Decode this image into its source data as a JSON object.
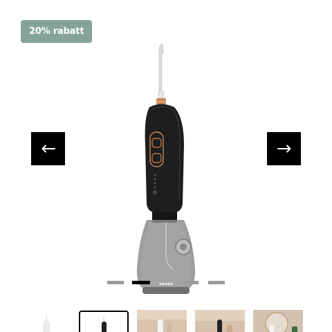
{
  "badge": {
    "label": "20% rabatt"
  },
  "product": {
    "image_icon": "water-flosser-image"
  },
  "carousel": {
    "prev_icon": "arrow-left-icon",
    "next_icon": "arrow-right-icon",
    "active_dot_index": 1,
    "dot_count": 4
  },
  "thumbnails": {
    "selected_index": 1,
    "items": [
      {
        "icon": "water-flosser-white-thumb"
      },
      {
        "icon": "water-flosser-black-thumb"
      },
      {
        "icon": "lifestyle-photo-thumb"
      },
      {
        "icon": "lifestyle-photo-thumb"
      },
      {
        "icon": "bathroom-photo-thumb"
      }
    ]
  },
  "colors": {
    "badge_bg": "#86a398",
    "arrow_bg": "#000000",
    "accent_copper": "#c9865a",
    "dot_inactive": "#9a9a9a"
  }
}
